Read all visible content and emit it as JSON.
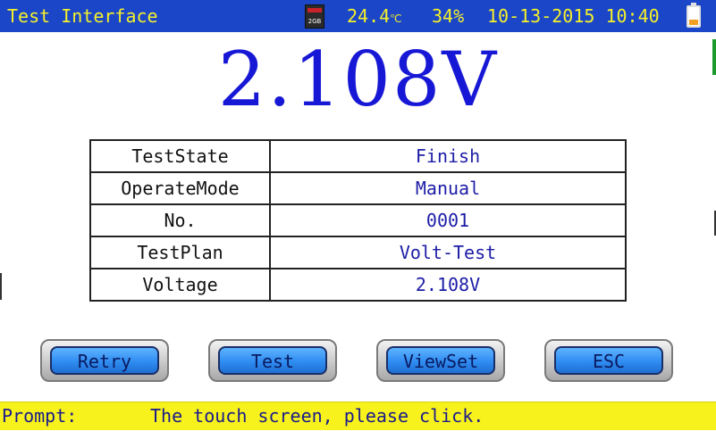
{
  "header": {
    "title": "Test Interface",
    "sd_card_label": "2GB",
    "sd_card_icon": "sd-card-icon",
    "temperature": "24.4",
    "temperature_unit": "℃",
    "battery_percent": "34%",
    "date": "10-13-2015",
    "time": "10:40",
    "battery_icon": "battery-icon",
    "battery_level": 0.34
  },
  "reading": {
    "value": "2.108V",
    "color": "#1717d6"
  },
  "table": {
    "rows": [
      {
        "label": "TestState",
        "value": "Finish"
      },
      {
        "label": "OperateMode",
        "value": "Manual"
      },
      {
        "label": "No.",
        "value": "0001"
      },
      {
        "label": "TestPlan",
        "value": "Volt-Test"
      },
      {
        "label": "Voltage",
        "value": "2.108V"
      }
    ]
  },
  "buttons": {
    "retry": "Retry",
    "test": "Test",
    "viewset": "ViewSet",
    "esc": "ESC"
  },
  "prompt": {
    "label": "Prompt:",
    "message": "The touch screen, please click."
  },
  "colors": {
    "title_bar": "#1b46c8",
    "title_text": "#f4f02a",
    "prompt_bar": "#f7f21c",
    "button_face": "#2f8cf0"
  }
}
